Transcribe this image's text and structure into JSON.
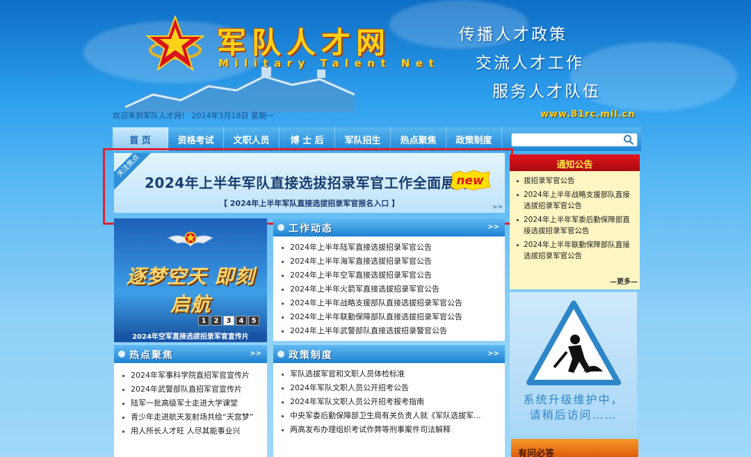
{
  "header": {
    "site_title": "军队人才网",
    "site_subtitle": "Military Talent Net",
    "slogans": [
      "传播人才政策",
      "交流人才工作",
      "服务人才队伍"
    ],
    "welcome": "欢迎来到军队人才网！ 2024年3月18日 星期一",
    "url": "www.81rc.mil.cn"
  },
  "nav": {
    "items": [
      "首 页",
      "资格考试",
      "文职人员",
      "博 士 后",
      "军队招生",
      "热点聚焦",
      "政策制度"
    ],
    "active_index": 0
  },
  "search": {
    "placeholder": ""
  },
  "banner": {
    "tag": "关注焦点",
    "headline": "2024年上半年军队直接选拔招录军官工作全面展开",
    "badge": "new",
    "link": "【 2024年上半年军队直接选拔招录军官报名入口 】",
    "more": ">>"
  },
  "slideshow": {
    "slide_text": "逐梦空天 即刻启航",
    "caption": "2024年空军直接选拔招录军官宣传片",
    "page_numbers": [
      "1",
      "2",
      "3",
      "4",
      "5"
    ],
    "current_page": "3"
  },
  "work_news": {
    "title": "工作动态",
    "more": ">>",
    "items": [
      "2024年上半年陆军直接选拔招录军官公告",
      "2024年上半年海军直接选拔招录军官公告",
      "2024年上半年空军直接选拔招录军官公告",
      "2024年上半年火箭军直接选拔招录军官公告",
      "2024年上半年战略支援部队直接选拔招录军官公告",
      "2024年上半年联勤保障部队直接选拔招录军官公告",
      "2024年上半年武警部队直接选拔招录警官公告"
    ]
  },
  "hot_topics": {
    "title": "热点聚焦",
    "more": ">>",
    "items": [
      "2024年军事科学院直招军官宣传片",
      "2024年武警部队直招军官宣传片",
      "陆军一批高级军士走进大学课堂",
      "青少年走进航天发射场共绘“天宫梦”",
      "用人所长人才旺 人尽其能事业兴"
    ]
  },
  "policy": {
    "title": "政策制度",
    "more": ">>",
    "items": [
      "军队选拔军官和文职人员体检标准",
      "2024年军队文职人员公开招考公告",
      "2024年军队文职人员公开招考报考指南",
      "中央军委后勤保障部卫生局有关负责人就《军队选拔军...",
      "两高发布办理组织考试作弊等刑事案件司法解释"
    ]
  },
  "notice": {
    "title": "通知公告",
    "items": [
      "拔招录军官公告",
      "2024年上半年战略支援部队直接选拔招录军官公告",
      "2024年上半年军委后勤保障部直接选拔招录军官公告",
      "2024年上半年联勤保障部队直接选拔招录军官公告"
    ],
    "more": "—更多—"
  },
  "maintenance": {
    "lines": [
      "系统升级维护中，",
      "请稍后访问……"
    ]
  },
  "faq": {
    "label": "有问必答"
  },
  "colors": {
    "highlight": "#e0202c",
    "nav_blue": "#1f86d6",
    "title_gold": "#ffd21a",
    "notice_red": "#c4111a"
  }
}
